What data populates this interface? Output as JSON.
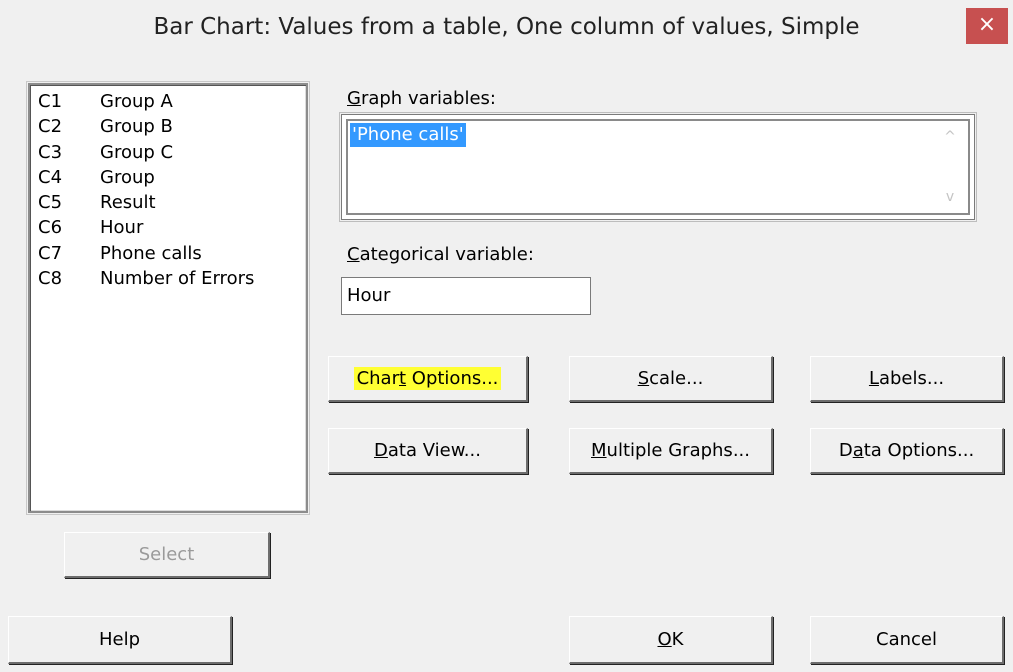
{
  "window": {
    "title": "Bar Chart: Values from a table, One column of values, Simple",
    "close_glyph": "×"
  },
  "variables": [
    {
      "code": "C1",
      "name": "Group A"
    },
    {
      "code": "C2",
      "name": "Group B"
    },
    {
      "code": "C3",
      "name": "Group C"
    },
    {
      "code": "C4",
      "name": "Group"
    },
    {
      "code": "C5",
      "name": "Result"
    },
    {
      "code": "C6",
      "name": "Hour"
    },
    {
      "code": "C7",
      "name": "Phone calls"
    },
    {
      "code": "C8",
      "name": "Number of Errors"
    }
  ],
  "graph_variables": {
    "label_mnemonic": "G",
    "label_rest": "raph variables:",
    "value": "'Phone calls'",
    "scroll_up": "^",
    "scroll_down": "v"
  },
  "categorical_variable": {
    "label_mnemonic": "C",
    "label_rest": "ategorical variable:",
    "value": "Hour"
  },
  "buttons": {
    "chart_options": {
      "pre": "Char",
      "mnemonic": "t",
      "post": " Options..."
    },
    "scale": {
      "pre": "",
      "mnemonic": "S",
      "post": "cale..."
    },
    "labels": {
      "pre": "",
      "mnemonic": "L",
      "post": "abels..."
    },
    "data_view": {
      "pre": "",
      "mnemonic": "D",
      "post": "ata View..."
    },
    "multiple_graphs": {
      "pre": "",
      "mnemonic": "M",
      "post": "ultiple Graphs..."
    },
    "data_options": {
      "pre": "D",
      "mnemonic": "a",
      "post": "ta Options..."
    },
    "select": "Select",
    "help": "Help",
    "ok": {
      "pre": "",
      "mnemonic": "O",
      "post": "K"
    },
    "cancel": "Cancel"
  },
  "colors": {
    "highlight": "#ffff33",
    "selection": "#3399ff",
    "close_button": "#c75050"
  }
}
